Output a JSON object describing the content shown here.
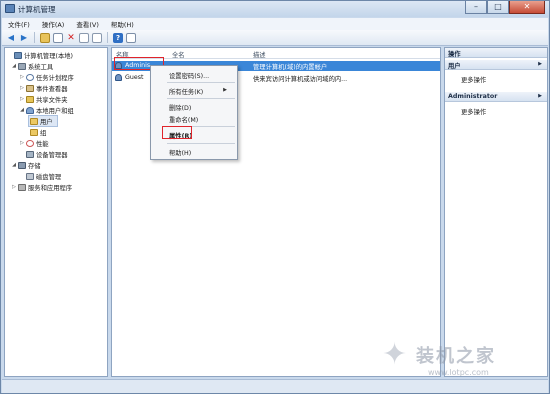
{
  "window": {
    "title": "计算机管理"
  },
  "menu": [
    "文件(F)",
    "操作(A)",
    "查看(V)",
    "帮助(H)"
  ],
  "tree": [
    {
      "label": "计算机管理(本地)",
      "icon": "computer-icon",
      "level": 0,
      "exp": ""
    },
    {
      "label": "系统工具",
      "icon": "tools-icon",
      "level": 1,
      "exp": "◢"
    },
    {
      "label": "任务计划程序",
      "icon": "clock-icon",
      "level": 2,
      "exp": "▷"
    },
    {
      "label": "事件查看器",
      "icon": "event-log-icon",
      "level": 2,
      "exp": "▷"
    },
    {
      "label": "共享文件夹",
      "icon": "share-folder-icon",
      "level": 2,
      "exp": "▷"
    },
    {
      "label": "本地用户和组",
      "icon": "users-icon",
      "level": 2,
      "exp": "◢"
    },
    {
      "label": "用户",
      "icon": "folder-icon",
      "level": 3,
      "exp": "",
      "selected": true
    },
    {
      "label": "组",
      "icon": "folder-icon",
      "level": 3,
      "exp": ""
    },
    {
      "label": "性能",
      "icon": "performance-icon",
      "level": 2,
      "exp": "▷"
    },
    {
      "label": "设备管理器",
      "icon": "device-manager-icon",
      "level": 2,
      "exp": ""
    },
    {
      "label": "存储",
      "icon": "storage-icon",
      "level": 1,
      "exp": "◢"
    },
    {
      "label": "磁盘管理",
      "icon": "disk-icon",
      "level": 2,
      "exp": ""
    },
    {
      "label": "服务和应用程序",
      "icon": "services-icon",
      "level": 1,
      "exp": "▷"
    }
  ],
  "list": {
    "headers": [
      "名称",
      "全名",
      "描述"
    ],
    "rows": [
      {
        "name": "Adminis",
        "fullname": "",
        "desc": "管理计算机(域)的内置帐户",
        "selected": true
      },
      {
        "name": "Guest",
        "fullname": "",
        "desc": "供来宾访问计算机或访问域的内..."
      }
    ]
  },
  "context_menu": {
    "items": [
      "设置密码(S)...",
      "所有任务(K)",
      "删除(D)",
      "重命名(M)",
      "属性(R)",
      "帮助(H)"
    ],
    "submenu_arrow": "▶"
  },
  "actions": {
    "header": "操作",
    "sections": [
      {
        "title": "用户",
        "item": "更多操作"
      },
      {
        "title": "Administrator",
        "item": "更多操作"
      }
    ],
    "arrow": "▶"
  },
  "watermark": {
    "text": "装机之家",
    "url": "www.lotpc.com"
  },
  "colors": {
    "selection": "#3a86d8",
    "highlight_box": "#e0242b"
  }
}
